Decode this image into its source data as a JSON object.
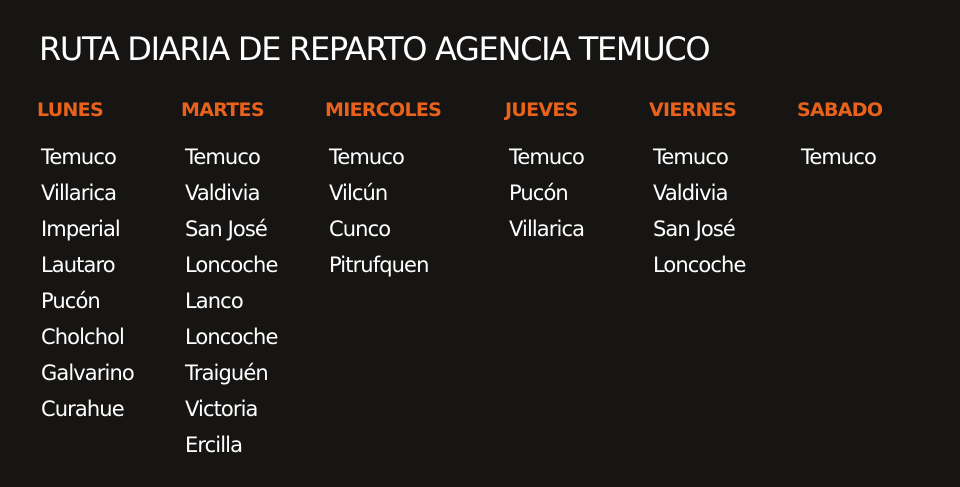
{
  "title": "RUTA DIARIA DE REPARTO AGENCIA TEMUCO",
  "colors": {
    "background": "#161513",
    "accent": "#e8621b",
    "text": "#ffffff"
  },
  "days": [
    {
      "name": "LUNES",
      "cities": [
        "Temuco",
        "Villarica",
        "Imperial",
        "Lautaro",
        "Pucón",
        "Cholchol",
        "Galvarino",
        "Curahue"
      ]
    },
    {
      "name": "MARTES",
      "cities": [
        "Temuco",
        "Valdivia",
        "San José",
        "Loncoche",
        "Lanco",
        "Loncoche",
        "Traiguén",
        "Victoria",
        "Ercilla"
      ]
    },
    {
      "name": "MIERCOLES",
      "cities": [
        "Temuco",
        "Vilcún",
        "Cunco",
        "Pitrufquen"
      ]
    },
    {
      "name": "JUEVES",
      "cities": [
        "Temuco",
        "Pucón",
        "Villarica"
      ]
    },
    {
      "name": "VIERNES",
      "cities": [
        "Temuco",
        "Valdivia",
        "San José",
        "Loncoche"
      ]
    },
    {
      "name": "SABADO",
      "cities": [
        "Temuco"
      ]
    }
  ]
}
